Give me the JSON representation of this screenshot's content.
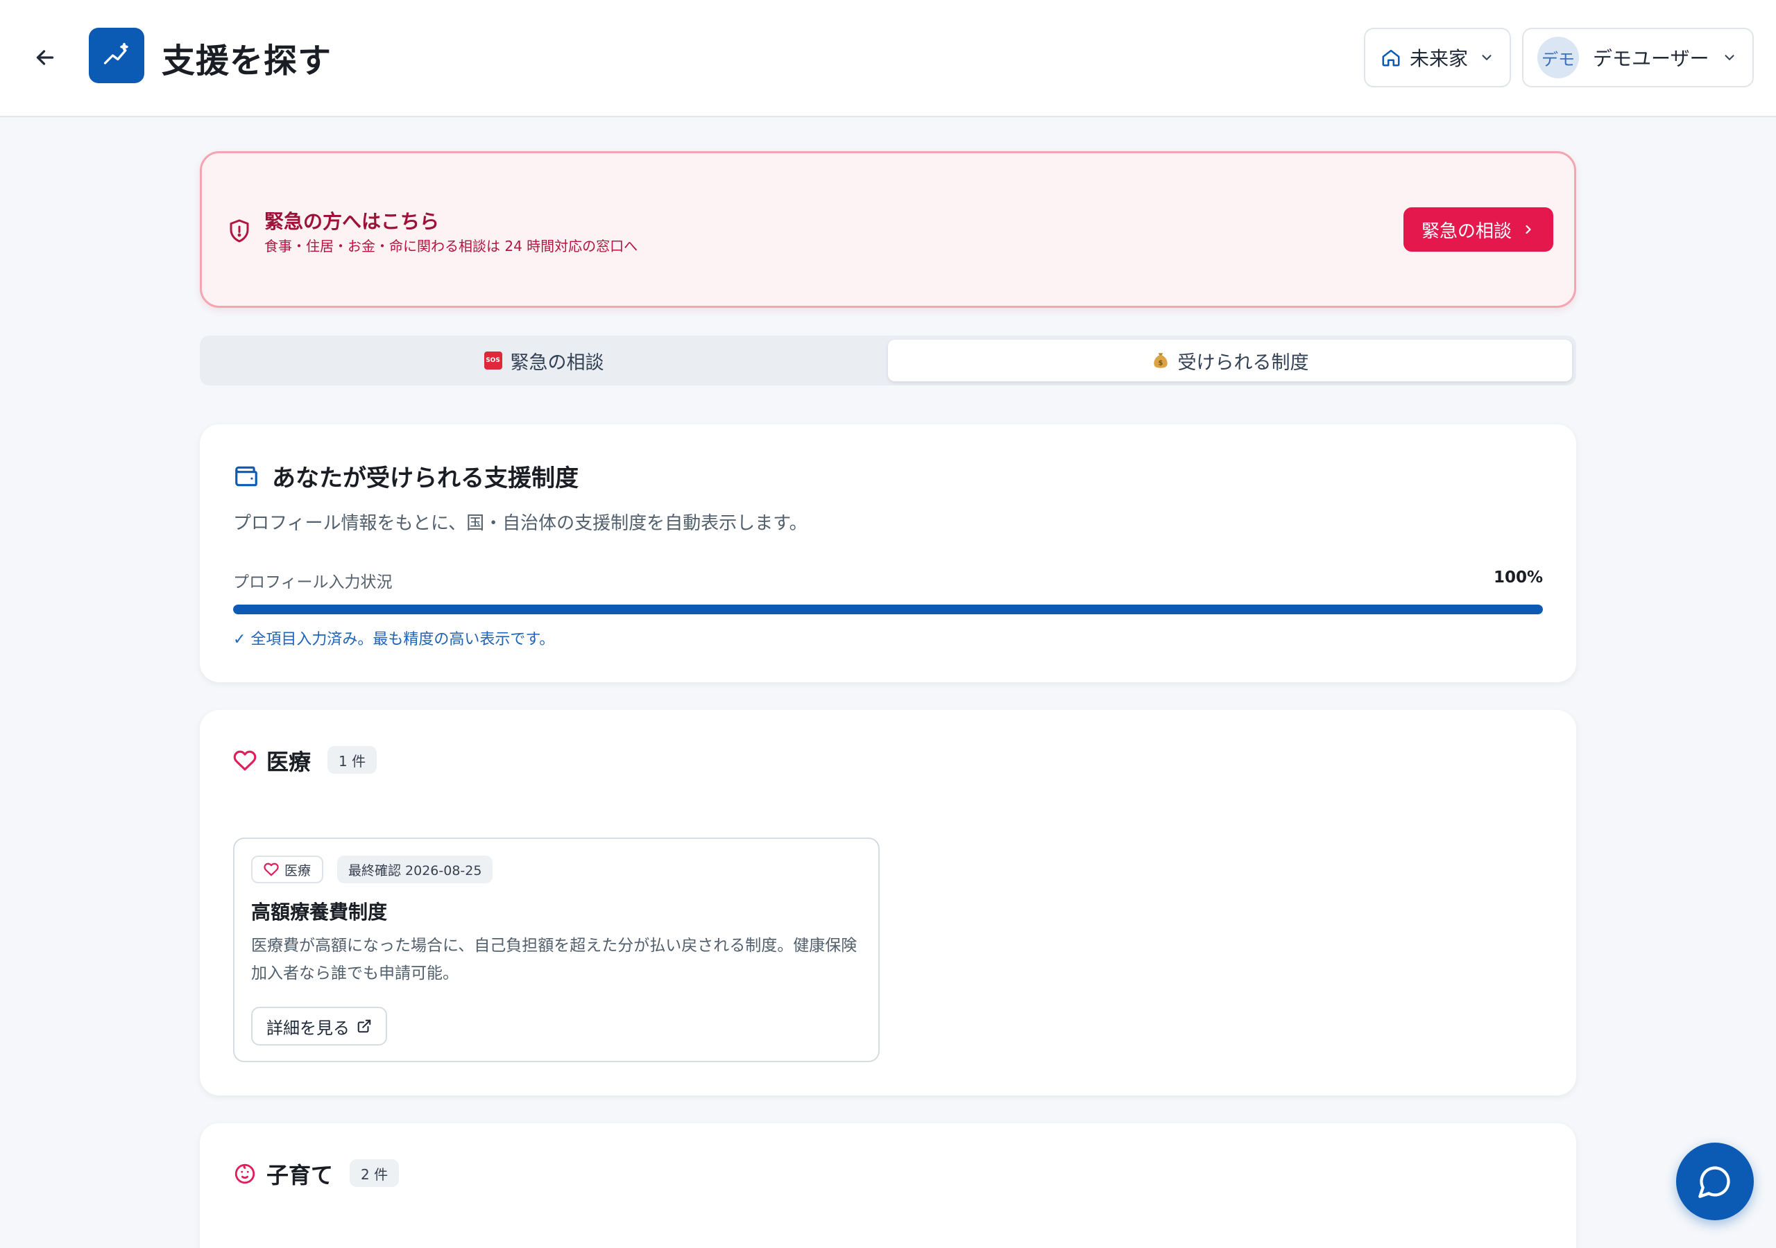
{
  "header": {
    "title": "支援を探す",
    "household": "未来家",
    "avatar_initials": "デモ",
    "user_name": "デモユーザー",
    "accent_color": "#0b5bb5"
  },
  "banner": {
    "title": "緊急の方へはこちら",
    "subtitle": "食事・住居・お金・命に関わる相談は 24 時間対応の窓口へ",
    "button_label": "緊急の相談",
    "accent_color": "#e5184e"
  },
  "tabs": [
    {
      "label": "緊急の相談",
      "icon": "sos-icon",
      "selected": false
    },
    {
      "label": "受けられる制度",
      "icon": "money-bag-icon",
      "selected": true
    }
  ],
  "summary": {
    "title": "あなたが受けられる支援制度",
    "description": "プロフィール情報をもとに、国・自治体の支援制度を自動表示します。",
    "progress_label": "プロフィール入力状況",
    "progress_value": "100%",
    "progress_fraction": 1.0,
    "progress_note": "✓ 全項目入力済み。最も精度の高い表示です。"
  },
  "sections": [
    {
      "title": "医療",
      "count": "1 件",
      "icon": "heart-icon",
      "programs": [
        {
          "category": "医療",
          "last_checked": "最終確認 2026-08-25",
          "title": "高額療養費制度",
          "description": "医療費が高額になった場合に、自己負担額を超えた分が払い戻される制度。健康保険加入者なら誰でも申請可能。",
          "detail_label": "詳細を見る"
        }
      ]
    },
    {
      "title": "子育て",
      "count": "2 件",
      "icon": "baby-icon",
      "programs": []
    }
  ]
}
